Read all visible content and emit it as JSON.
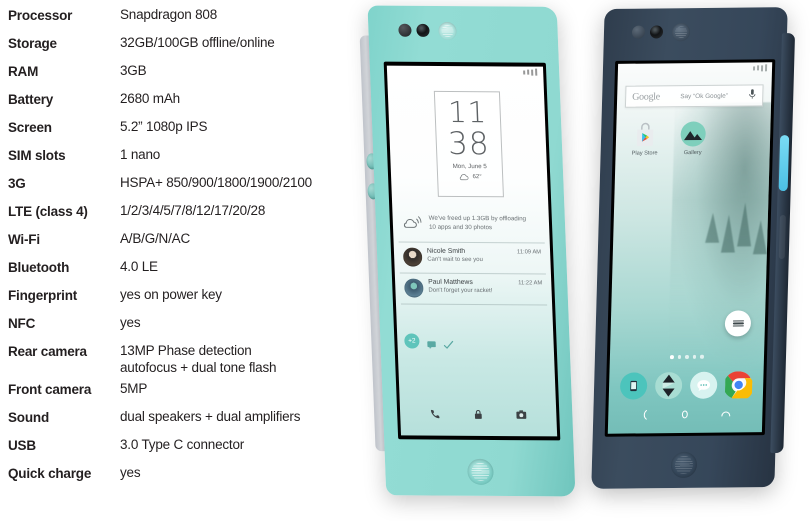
{
  "specs": {
    "rows": [
      {
        "label": "Processor",
        "value": "Snapdragon 808"
      },
      {
        "label": "Storage",
        "value": "32GB/100GB offline/online"
      },
      {
        "label": "RAM",
        "value": "3GB"
      },
      {
        "label": "Battery",
        "value": "2680 mAh"
      },
      {
        "label": "Screen",
        "value": "5.2” 1080p IPS"
      },
      {
        "label": "SIM slots",
        "value": "1 nano"
      },
      {
        "label": "3G",
        "value": "HSPA+ 850/900/1800/1900/2100"
      },
      {
        "label": "LTE (class 4)",
        "value": "1/2/3/4/5/7/8/12/17/20/28"
      },
      {
        "label": "Wi-Fi",
        "value": "A/B/G/N/AC"
      },
      {
        "label": "Bluetooth",
        "value": "4.0 LE"
      },
      {
        "label": "Fingerprint",
        "value": "yes on power key"
      },
      {
        "label": "NFC",
        "value": "yes"
      },
      {
        "label": "Rear camera",
        "value": "13MP Phase detection",
        "value2": "autofocus + dual tone flash"
      },
      {
        "label": "Front camera",
        "value": "5MP"
      },
      {
        "label": "Sound",
        "value": "dual speakers + dual amplifiers"
      },
      {
        "label": "USB",
        "value": "3.0 Type C connector"
      },
      {
        "label": "Quick charge",
        "value": "yes"
      }
    ]
  },
  "phone_mint": {
    "body_color": "#8fd9d1",
    "edge_color": "#dfe3e8",
    "button_color": "#7fd0c8",
    "lockscreen": {
      "clock_hours": "11",
      "clock_minutes": "38",
      "date": "Mon, June 5",
      "temperature": "62°",
      "weather_icon": "cloud-icon",
      "notifications": [
        {
          "type": "system",
          "icon": "cloud-sync-icon",
          "line1": "We've freed up 1.3GB by offloading",
          "line2": "10 apps and 30 photos"
        },
        {
          "type": "message",
          "icon": "avatar",
          "title": "Nicole Smith",
          "time": "11:09 AM",
          "preview": "Can't wait to see you"
        },
        {
          "type": "message",
          "icon": "avatar",
          "title": "Paul Matthews",
          "time": "11:22 AM",
          "preview": "Don't forget your racket!"
        }
      ],
      "more_badge": "+2",
      "quick_actions": [
        "message-icon",
        "check-icon"
      ],
      "shortcuts": [
        "phone-icon",
        "lock-icon",
        "camera-icon"
      ]
    }
  },
  "phone_navy": {
    "body_color": "#36475a",
    "power_button_color": "#5ec8e8",
    "homescreen": {
      "search": {
        "logo_text": "Google",
        "placeholder": "Say “Ok Google”",
        "mic_icon": "microphone-icon"
      },
      "apps": [
        {
          "name": "Play Store",
          "icon": "play-store-icon"
        },
        {
          "name": "Gallery",
          "icon": "gallery-icon"
        }
      ],
      "fab_icon": "menu-icon",
      "page_dots": 5,
      "page_active": 1,
      "dock": [
        {
          "name": "Phone",
          "icon": "phone-icon"
        },
        {
          "name": "Nextbit",
          "icon": "nextbit-icon"
        },
        {
          "name": "Messages",
          "icon": "messages-icon"
        },
        {
          "name": "Chrome",
          "icon": "chrome-icon"
        }
      ],
      "nav": [
        "back-icon",
        "home-icon",
        "recents-icon"
      ]
    }
  }
}
